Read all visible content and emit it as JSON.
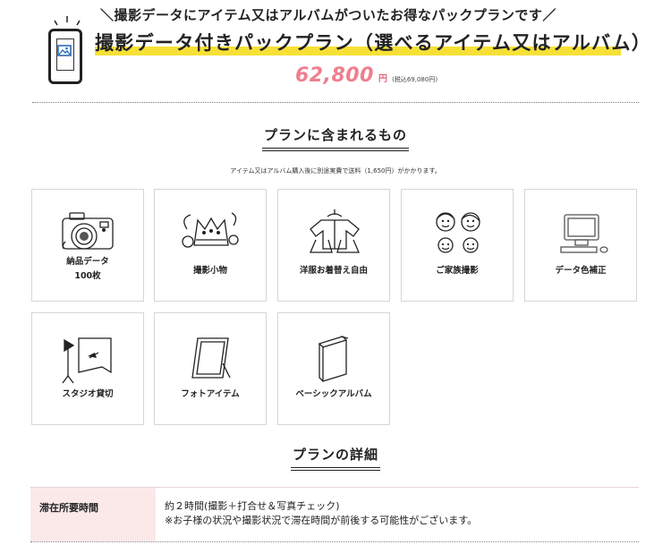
{
  "header": {
    "tagline": "＼撮影データにアイテム又はアルバムがついたお得なパックプランです／",
    "title": "撮影データ付きパックプラン（選べるアイテム又はアルバム）",
    "price": "62,800",
    "price_unit": "円",
    "price_tax_in": "(税込69,080円)",
    "accent_color": "#f07e8e",
    "highlight_color": "#f7e036"
  },
  "included": {
    "heading": "プランに含まれるもの",
    "note": "アイテム又はアルバム購入後に別途実費で送料（1,650円）がかかります。",
    "items": [
      {
        "icon": "camera-icon",
        "label": "納品データ",
        "sub": "100枚"
      },
      {
        "icon": "small-props-icon",
        "label": "撮影小物"
      },
      {
        "icon": "clothes-icon",
        "label": "洋服お着替え自由"
      },
      {
        "icon": "family-icon",
        "label": "ご家族撮影"
      },
      {
        "icon": "computer-icon",
        "label": "データ色補正"
      },
      {
        "icon": "studio-lighting-icon",
        "label": "スタジオ貸切"
      },
      {
        "icon": "photo-frame-icon",
        "label": "フォトアイテム"
      },
      {
        "icon": "album-icon",
        "label": "ベーシックアルバム"
      }
    ]
  },
  "details": {
    "heading": "プランの詳細",
    "rows": [
      {
        "key": "滞在所要時間",
        "line1": "約２時間(撮影＋打合せ＆写真チェック)",
        "line2": "※お子様の状況や撮影状況で滞在時間が前後する可能性がございます。"
      }
    ]
  }
}
